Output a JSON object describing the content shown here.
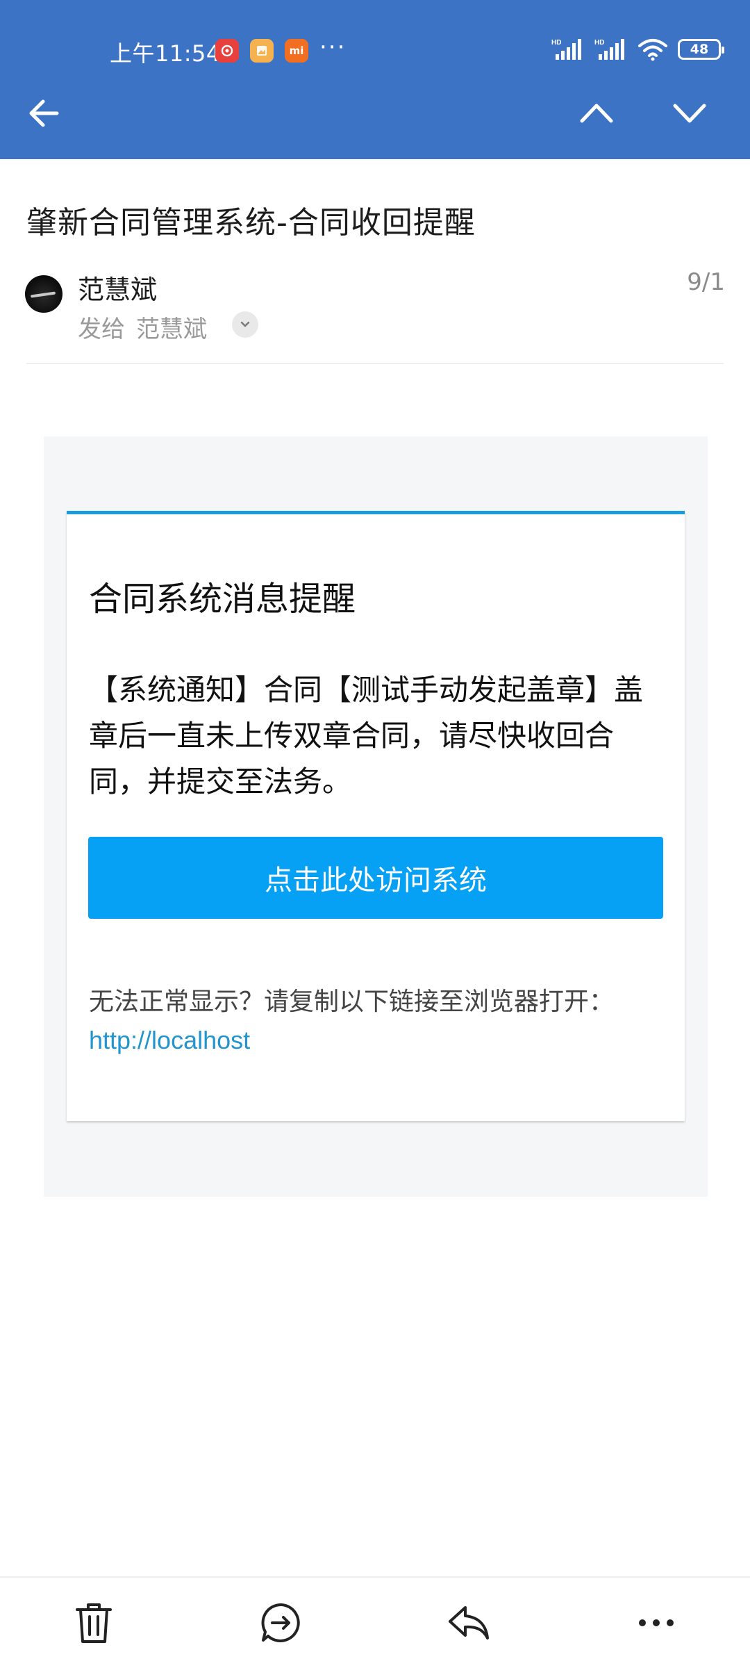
{
  "status_bar": {
    "time": "上午11:54",
    "more": "···",
    "battery": "48",
    "hd1": "HD",
    "hd2": "HD",
    "mi_label": "mi"
  },
  "header": {
    "background": "#3d73c5"
  },
  "mail": {
    "subject": "肇新合同管理系统-合同收回提醒",
    "sender": "范慧斌",
    "send_to_label": "发给",
    "recipient": "范慧斌",
    "date": "9/1"
  },
  "content": {
    "card_title": "合同系统消息提醒",
    "message": "【系统通知】合同【测试手动发起盖章】盖章后一直未上传双章合同，请尽快收回合同，并提交至法务。",
    "button_label": "点击此处访问系统",
    "fallback_text": "无法正常显示？请复制以下链接至浏览器打开：",
    "link": "http://localhost",
    "accent_color": "#1a9cd8",
    "button_color": "#06a0f5"
  },
  "icons": {
    "back": "back-arrow-icon",
    "prev": "chevron-up-icon",
    "next": "chevron-down-icon",
    "delete": "trash-icon",
    "forward": "forward-chat-icon",
    "reply": "reply-icon",
    "more": "more-icon"
  }
}
